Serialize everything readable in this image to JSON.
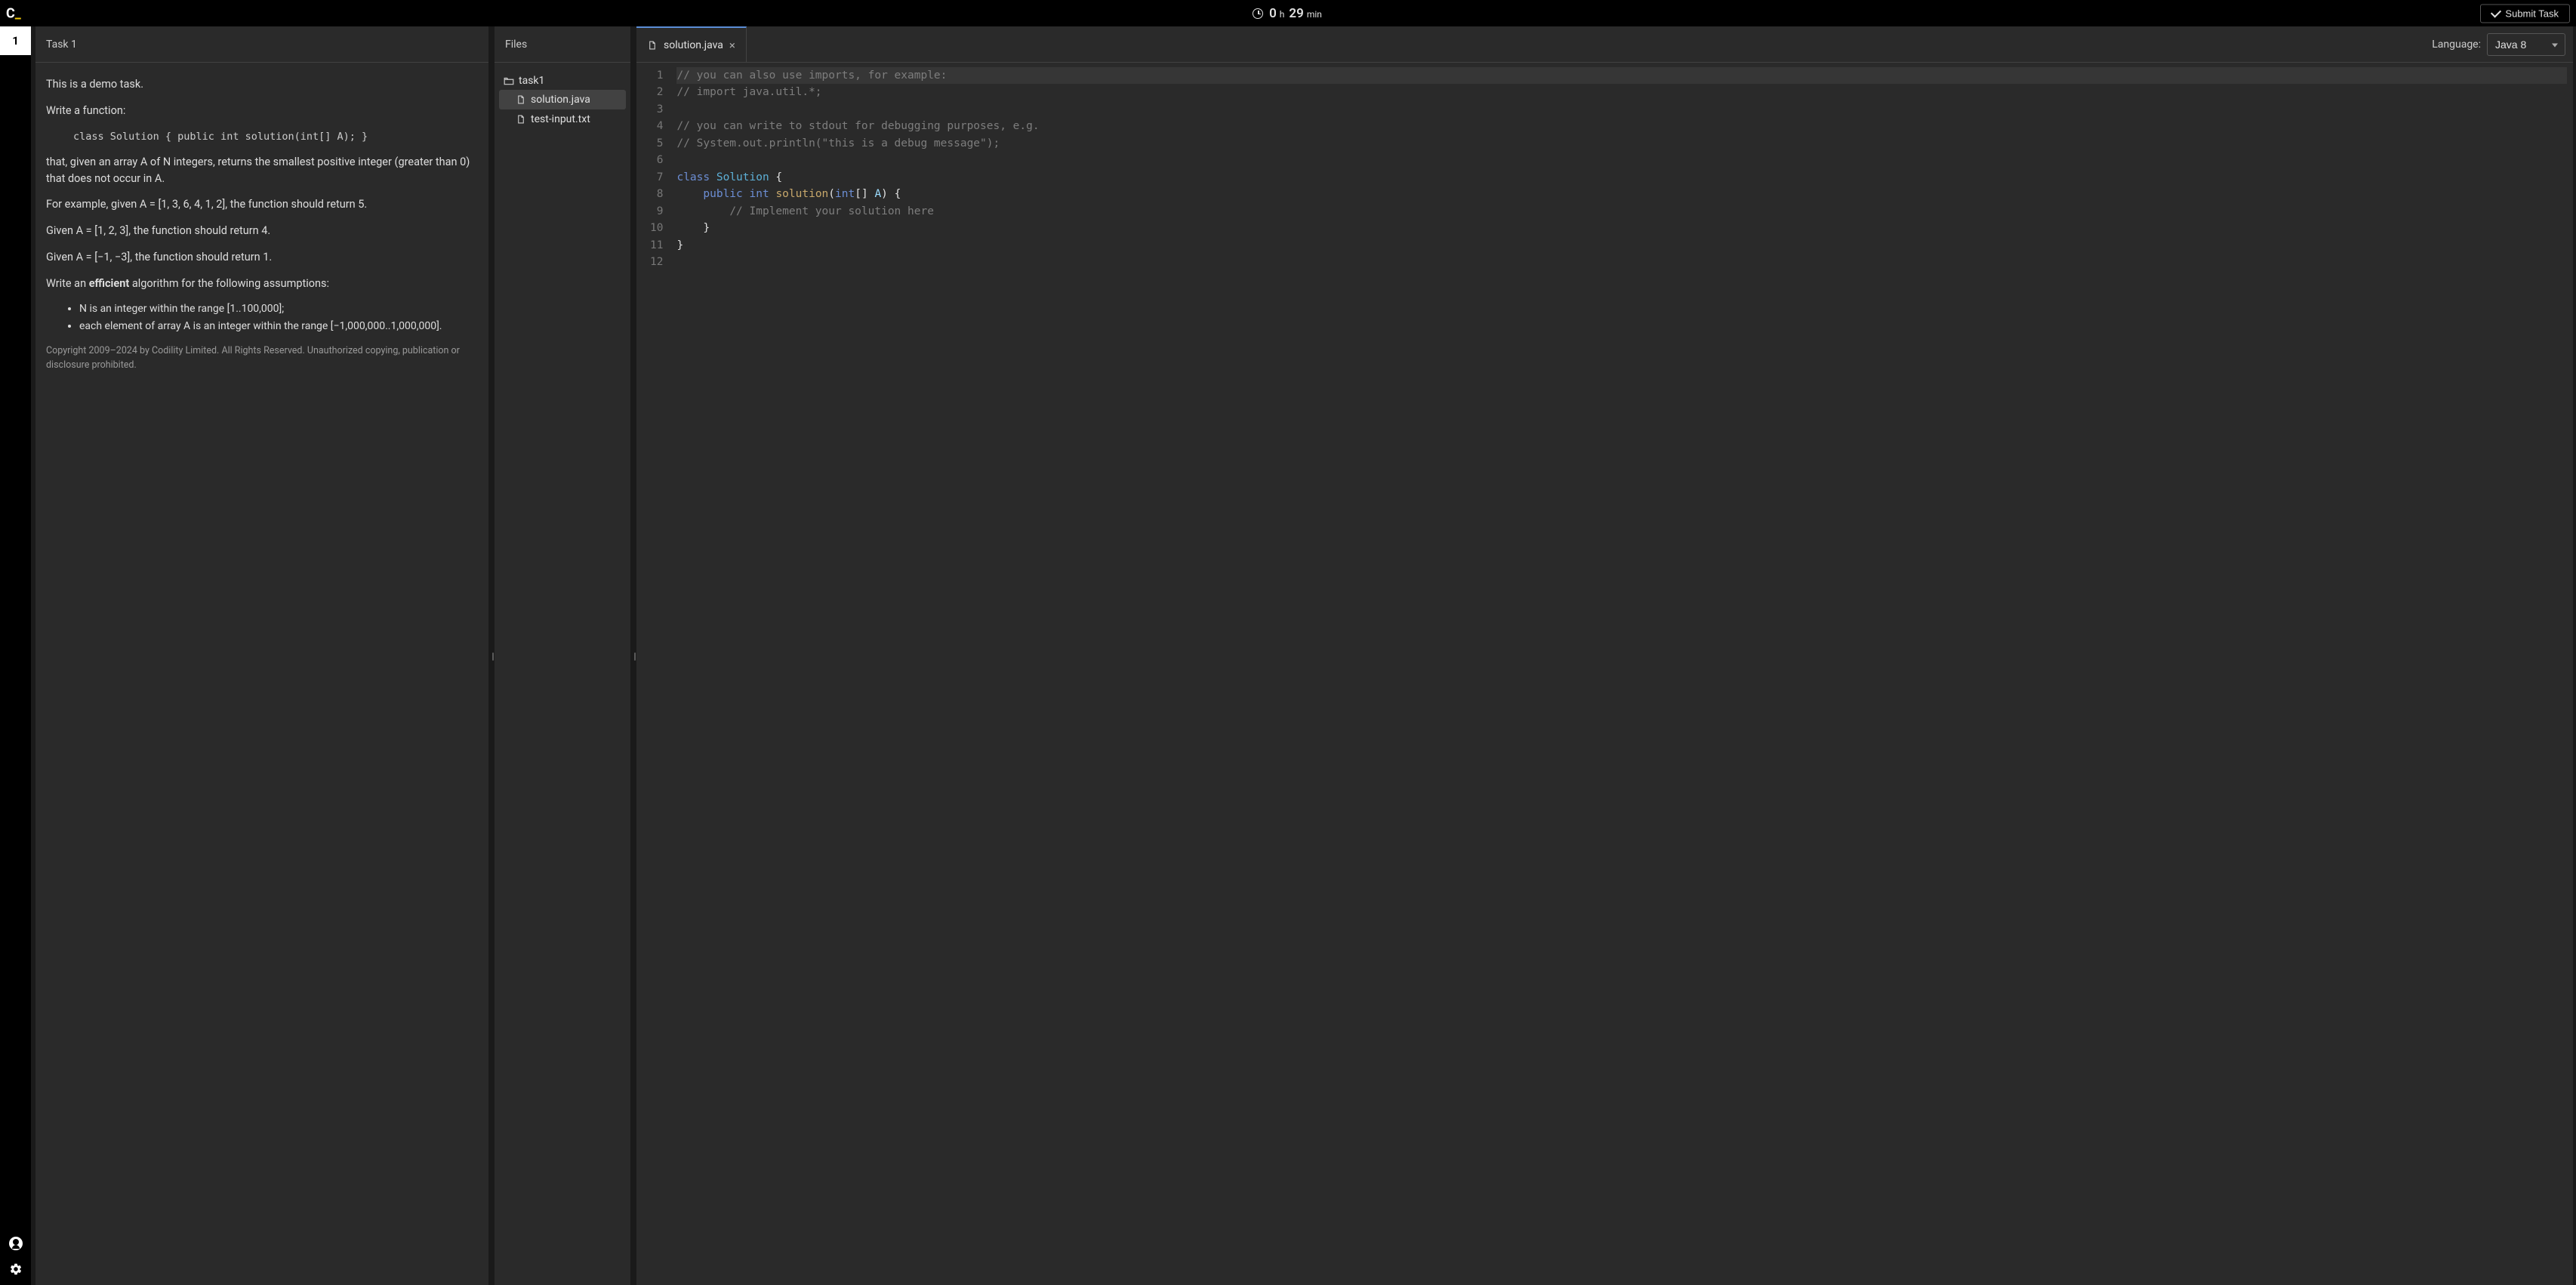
{
  "header": {
    "timer_hours": "0",
    "timer_h_label": "h",
    "timer_mins": "29",
    "timer_min_label": "min",
    "submit_label": "Submit Task"
  },
  "sidebar": {
    "task_number": "1"
  },
  "task_panel": {
    "title": "Task 1",
    "intro": "This is a demo task.",
    "write_fn": "Write a function:",
    "signature": "class Solution { public int solution(int[] A); }",
    "desc": "that, given an array A of N integers, returns the smallest positive integer (greater than 0) that does not occur in A.",
    "ex1": "For example, given A = [1, 3, 6, 4, 1, 2], the function should return 5.",
    "ex2": "Given A = [1, 2, 3], the function should return 4.",
    "ex3": "Given A = [−1, −3], the function should return 1.",
    "assume_prefix": "Write an ",
    "assume_bold": "efficient",
    "assume_suffix": " algorithm for the following assumptions:",
    "bullet1": "N is an integer within the range [1..100,000];",
    "bullet2": "each element of array A is an integer within the range [−1,000,000..1,000,000].",
    "copyright": "Copyright 2009–2024 by Codility Limited. All Rights Reserved. Unauthorized copying, publication or disclosure prohibited."
  },
  "files_panel": {
    "title": "Files",
    "folder": "task1",
    "file1": "solution.java",
    "file2": "test-input.txt"
  },
  "editor": {
    "tab_name": "solution.java",
    "language_label": "Language:",
    "language_value": "Java 8",
    "gutter": [
      "1",
      "2",
      "3",
      "4",
      "5",
      "6",
      "7",
      "8",
      "9",
      "10",
      "11",
      "12"
    ]
  },
  "code": {
    "l1": "// you can also use imports, for example:",
    "l2": "// import java.util.*;",
    "l4": "// you can write to stdout for debugging purposes, e.g.",
    "l5": "// System.out.println(\"this is a debug message\");",
    "l7_class": "class",
    "l7_name": "Solution",
    "l7_brace": " {",
    "l8_pad": "    ",
    "l8_public": "public",
    "l8_sp": " ",
    "l8_int": "int",
    "l8_method": "solution",
    "l8_open": "(",
    "l8_ptype": "int",
    "l8_arr": "[] ",
    "l8_param": "A",
    "l8_close": ") {",
    "l9_pad": "        ",
    "l9": "// Implement your solution here",
    "l10": "    }",
    "l11": "}"
  }
}
